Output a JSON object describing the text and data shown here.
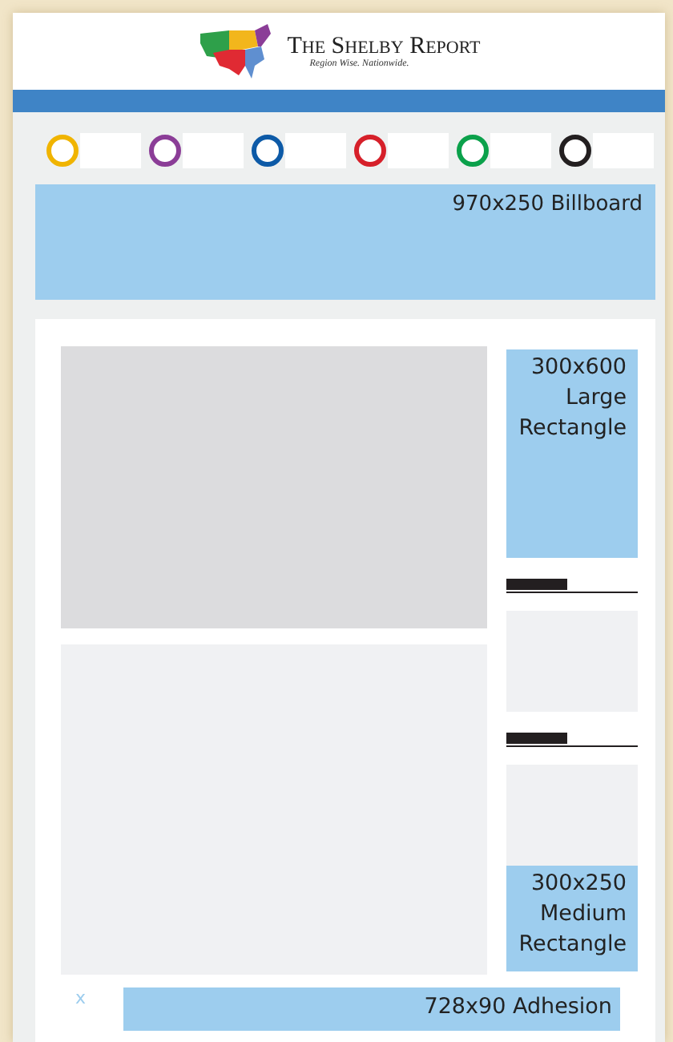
{
  "header": {
    "title": "The Shelby Report",
    "tagline": "Region Wise. Nationwide."
  },
  "nav_items": [
    {
      "color": "#f0b400"
    },
    {
      "color": "#8b3d97"
    },
    {
      "color": "#0d5aa7"
    },
    {
      "color": "#d6202a"
    },
    {
      "color": "#0ba14b"
    },
    {
      "color": "#231f20"
    }
  ],
  "billboard": {
    "label": "970x250 Billboard"
  },
  "sidebar": [
    {
      "kind": "large_ad",
      "label": "300x600\nLarge\nRectangle"
    },
    {
      "kind": "heading"
    },
    {
      "kind": "block"
    },
    {
      "kind": "heading"
    },
    {
      "kind": "block"
    },
    {
      "kind": "medium_ad",
      "label": "300x250\nMedium\nRectangle"
    }
  ],
  "adhesion": {
    "close": "x",
    "label": "728x90 Adhesion"
  }
}
